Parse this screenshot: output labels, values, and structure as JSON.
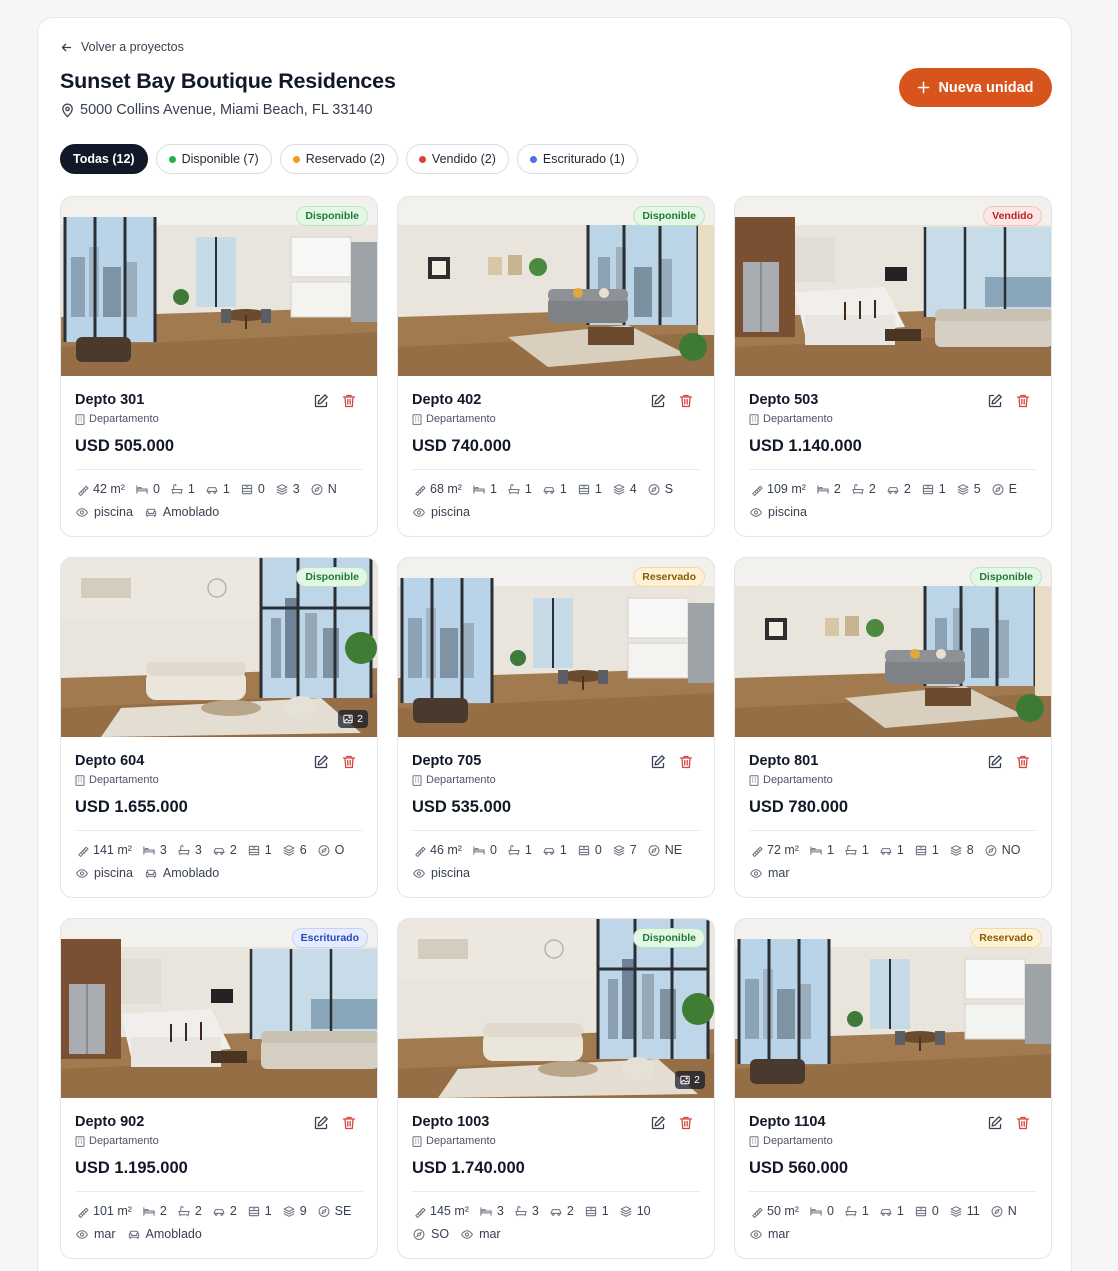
{
  "header": {
    "back_label": "Volver a proyectos",
    "title": "Sunset Bay Boutique Residences",
    "address": "5000 Collins Avenue, Miami Beach, FL 33140",
    "new_unit_label": "Nueva unidad"
  },
  "filters": [
    {
      "label": "Todas (12)",
      "active": true,
      "dot": null
    },
    {
      "label": "Disponible (7)",
      "active": false,
      "dot": "#22b14c"
    },
    {
      "label": "Reservado (2)",
      "active": false,
      "dot": "#f29d12"
    },
    {
      "label": "Vendido (2)",
      "active": false,
      "dot": "#d6453d"
    },
    {
      "label": "Escriturado (1)",
      "active": false,
      "dot": "#4f6ee8"
    }
  ],
  "units": [
    {
      "name": "Depto 301",
      "type": "Departamento",
      "price": "USD 505.000",
      "status": "Disponible",
      "status_key": "disp",
      "scene": "a",
      "img_count": "",
      "area": "42 m²",
      "beds": "0",
      "baths": "1",
      "parking": "1",
      "storage": "0",
      "floor": "3",
      "orientation": "N",
      "features": [
        "piscina",
        "Amoblado"
      ]
    },
    {
      "name": "Depto 402",
      "type": "Departamento",
      "price": "USD 740.000",
      "status": "Disponible",
      "status_key": "disp",
      "scene": "b",
      "img_count": "",
      "area": "68 m²",
      "beds": "1",
      "baths": "1",
      "parking": "1",
      "storage": "1",
      "floor": "4",
      "orientation": "S",
      "features": [
        "piscina"
      ]
    },
    {
      "name": "Depto 503",
      "type": "Departamento",
      "price": "USD 1.140.000",
      "status": "Vendido",
      "status_key": "vend",
      "scene": "c",
      "img_count": "",
      "area": "109 m²",
      "beds": "2",
      "baths": "2",
      "parking": "2",
      "storage": "1",
      "floor": "5",
      "orientation": "E",
      "features": [
        "piscina"
      ]
    },
    {
      "name": "Depto 604",
      "type": "Departamento",
      "price": "USD 1.655.000",
      "status": "Disponible",
      "status_key": "disp",
      "scene": "d",
      "img_count": "2",
      "area": "141 m²",
      "beds": "3",
      "baths": "3",
      "parking": "2",
      "storage": "1",
      "floor": "6",
      "orientation": "O",
      "features": [
        "piscina",
        "Amoblado"
      ]
    },
    {
      "name": "Depto 705",
      "type": "Departamento",
      "price": "USD 535.000",
      "status": "Reservado",
      "status_key": "res",
      "scene": "a",
      "img_count": "",
      "area": "46 m²",
      "beds": "0",
      "baths": "1",
      "parking": "1",
      "storage": "0",
      "floor": "7",
      "orientation": "NE",
      "features": [
        "piscina"
      ]
    },
    {
      "name": "Depto 801",
      "type": "Departamento",
      "price": "USD 780.000",
      "status": "Disponible",
      "status_key": "disp",
      "scene": "b",
      "img_count": "",
      "area": "72 m²",
      "beds": "1",
      "baths": "1",
      "parking": "1",
      "storage": "1",
      "floor": "8",
      "orientation": "NO",
      "features": [
        "mar"
      ]
    },
    {
      "name": "Depto 902",
      "type": "Departamento",
      "price": "USD 1.195.000",
      "status": "Escriturado",
      "status_key": "esc",
      "scene": "c",
      "img_count": "",
      "area": "101 m²",
      "beds": "2",
      "baths": "2",
      "parking": "2",
      "storage": "1",
      "floor": "9",
      "orientation": "SE",
      "features": [
        "mar",
        "Amoblado"
      ]
    },
    {
      "name": "Depto 1003",
      "type": "Departamento",
      "price": "USD 1.740.000",
      "status": "Disponible",
      "status_key": "disp",
      "scene": "d",
      "img_count": "2",
      "area": "145 m²",
      "beds": "3",
      "baths": "3",
      "parking": "2",
      "storage": "1",
      "floor": "10",
      "orientation": "SO",
      "features": [
        "mar"
      ]
    },
    {
      "name": "Depto 1104",
      "type": "Departamento",
      "price": "USD 560.000",
      "status": "Reservado",
      "status_key": "res",
      "scene": "a",
      "img_count": "",
      "area": "50 m²",
      "beds": "0",
      "baths": "1",
      "parking": "1",
      "storage": "0",
      "floor": "11",
      "orientation": "N",
      "features": [
        "mar"
      ]
    }
  ]
}
